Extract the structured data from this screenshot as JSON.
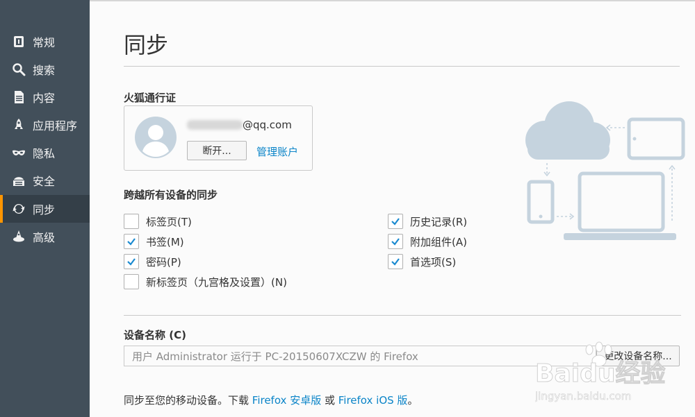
{
  "sidebar": {
    "items": [
      {
        "label": "常规",
        "icon": "general-icon",
        "active": false
      },
      {
        "label": "搜索",
        "icon": "search-icon",
        "active": false
      },
      {
        "label": "内容",
        "icon": "content-icon",
        "active": false
      },
      {
        "label": "应用程序",
        "icon": "applications-icon",
        "active": false
      },
      {
        "label": "隐私",
        "icon": "privacy-mask-icon",
        "active": false
      },
      {
        "label": "安全",
        "icon": "security-icon",
        "active": false
      },
      {
        "label": "同步",
        "icon": "sync-icon",
        "active": true
      },
      {
        "label": "高级",
        "icon": "advanced-icon",
        "active": false
      }
    ]
  },
  "main": {
    "title": "同步",
    "account": {
      "section_title": "火狐通行证",
      "email_visible": "@qq.com",
      "disconnect_label": "断开...",
      "manage_label": "管理账户"
    },
    "sync": {
      "section_title": "跨越所有设备的同步",
      "options": [
        {
          "label": "标签页(T)",
          "checked": false
        },
        {
          "label": "书签(M)",
          "checked": true
        },
        {
          "label": "密码(P)",
          "checked": true
        },
        {
          "label": "新标签页（九宫格及设置）(N)",
          "checked": false
        },
        {
          "label": "历史记录(R)",
          "checked": true
        },
        {
          "label": "附加组件(A)",
          "checked": true
        },
        {
          "label": "首选项(S)",
          "checked": true
        }
      ]
    },
    "device": {
      "section_title": "设备名称 (C)",
      "value": "用户 Administrator 运行于 PC-20150607XCZW 的 Firefox",
      "rename_label": "更改设备名称..."
    },
    "footer": {
      "prefix": "同步至您的移动设备。下载 ",
      "android_link": "Firefox 安卓版",
      "middle": " 或 ",
      "ios_link": "Firefox iOS 版",
      "suffix": "。"
    }
  },
  "watermark": {
    "brand": "Baidu经验",
    "url": "jingyan.baidu.com"
  },
  "colors": {
    "sidebar_bg": "#424f5a",
    "sidebar_active_bg": "#343f48",
    "accent": "#ff9500",
    "link": "#0a84c8",
    "checkmark": "#1a8ad0",
    "illustration": "#c5d3de"
  }
}
